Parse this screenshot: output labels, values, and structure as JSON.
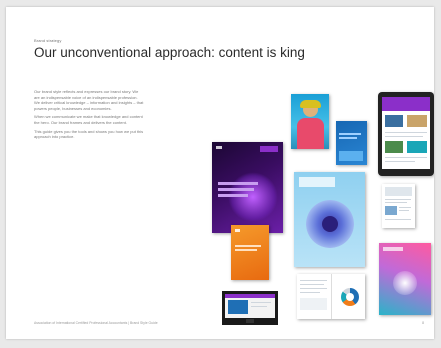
{
  "page": {
    "kicker": "Brand strategy",
    "title": "Our unconventional approach: content is king",
    "paragraphs": [
      "Our brand style reflects and expresses our brand story. We are an indispensable voice of an indispensable profession. We deliver critical knowledge – information and insights – that powers people, businesses and economies.",
      "When we communicate we make that knowledge and content the hero. Our brand frames and delivers the content.",
      "This guide gives you the tools and shows you how we put this approach into practice."
    ],
    "footer": "Association of International Certified Professional Accountants | Brand Style Guide",
    "page_number": "8"
  },
  "colors": {
    "purple_dark": "#2a0a45",
    "purple_accent": "#8b2fc9",
    "blue": "#1f6fb5",
    "orange": "#f07d1a",
    "teal": "#1aa6b7",
    "magenta": "#c2185b"
  }
}
